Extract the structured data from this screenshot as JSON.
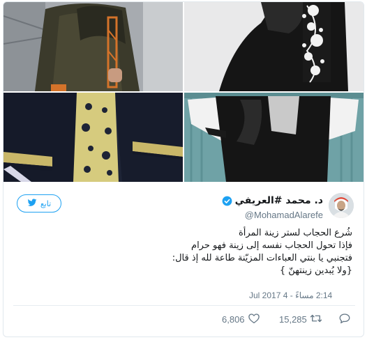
{
  "tweet": {
    "display_name": "د. محمد #العريفي",
    "handle": "@MohamadAlarefe",
    "follow_label": "تابع",
    "lines": [
      "شُرع الحجاب لستر زينة المرأة",
      "فإذا تحول الحجاب نفسه إلى زينة فهو حرام",
      "فتجنبي يا بنتي العباءات المزيّنة طاعة لله إذ قال:",
      "{ولا يُبدين زينتهنّ }"
    ],
    "timestamp": "2:14 مساءً - 4 Jul 2017",
    "likes": "6,806",
    "retweets": "15,285"
  },
  "colors": {
    "accent": "#1da1f2",
    "text": "#14171a",
    "muted": "#657786"
  },
  "icons": [
    "twitter-bird-icon",
    "verified-icon",
    "heart-icon",
    "retweet-icon",
    "reply-icon"
  ]
}
